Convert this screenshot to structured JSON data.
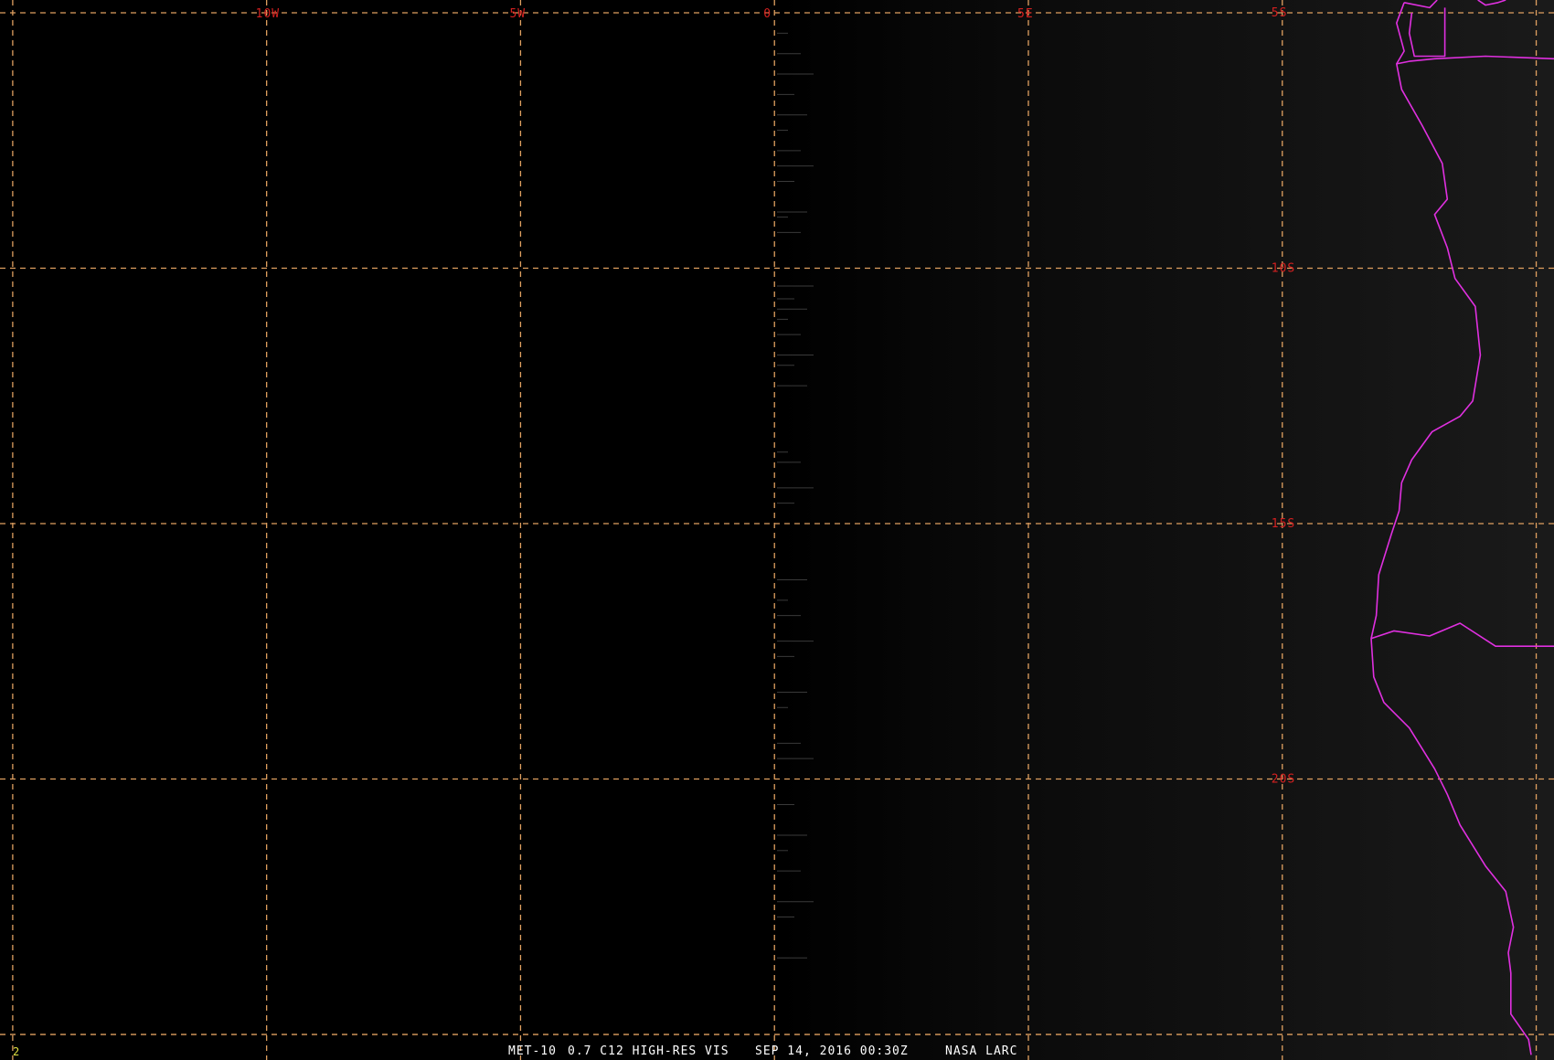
{
  "product": {
    "satellite": "MET-10",
    "channel": "0.7 C12 HIGH-RES VIS",
    "datetime": "SEP 14, 2016 00:30Z",
    "source": "NASA LARC",
    "frame_number": "2"
  },
  "grid": {
    "longitudes": [
      {
        "value": -15,
        "label": ""
      },
      {
        "value": -10,
        "label": "10W"
      },
      {
        "value": -5,
        "label": "5W"
      },
      {
        "value": 0,
        "label": "0"
      },
      {
        "value": 5,
        "label": "5E"
      },
      {
        "value": 10,
        "label": ""
      },
      {
        "value": 15,
        "label": ""
      }
    ],
    "latitudes": [
      {
        "value": -5,
        "label": "5S"
      },
      {
        "value": -10,
        "label": "10S"
      },
      {
        "value": -15,
        "label": "15S"
      },
      {
        "value": -20,
        "label": "20S"
      },
      {
        "value": -25,
        "label": ""
      }
    ],
    "label_longitude": 10
  },
  "extent": {
    "lon_min": -15.25,
    "lon_max": 15.35,
    "lat_max": -4.75,
    "lat_min": -25.5
  },
  "coastline": [
    [
      12.4,
      -4.8
    ],
    [
      12.25,
      -5.2
    ],
    [
      12.4,
      -5.75
    ],
    [
      12.25,
      -6.0
    ],
    [
      12.35,
      -6.5
    ],
    [
      12.75,
      -7.2
    ],
    [
      13.15,
      -7.95
    ],
    [
      13.25,
      -8.65
    ],
    [
      13.0,
      -8.95
    ],
    [
      13.25,
      -9.6
    ],
    [
      13.4,
      -10.2
    ],
    [
      13.8,
      -10.75
    ],
    [
      13.9,
      -11.7
    ],
    [
      13.75,
      -12.6
    ],
    [
      13.5,
      -12.9
    ],
    [
      12.95,
      -13.2
    ],
    [
      12.55,
      -13.75
    ],
    [
      12.35,
      -14.2
    ],
    [
      12.3,
      -14.75
    ],
    [
      12.15,
      -15.2
    ],
    [
      11.9,
      -16.0
    ],
    [
      11.85,
      -16.8
    ],
    [
      11.75,
      -17.25
    ],
    [
      11.8,
      -18.0
    ],
    [
      12.0,
      -18.5
    ],
    [
      12.5,
      -19.0
    ],
    [
      13.0,
      -19.8
    ],
    [
      13.25,
      -20.3
    ],
    [
      13.5,
      -20.9
    ],
    [
      14.0,
      -21.7
    ],
    [
      14.4,
      -22.2
    ],
    [
      14.55,
      -22.9
    ],
    [
      14.45,
      -23.4
    ],
    [
      14.5,
      -23.8
    ],
    [
      14.5,
      -24.6
    ],
    [
      14.85,
      -25.1
    ],
    [
      14.9,
      -25.4
    ]
  ],
  "borders": [
    [
      [
        12.4,
        -4.8
      ],
      [
        12.9,
        -4.9
      ],
      [
        13.05,
        -4.75
      ]
    ],
    [
      [
        13.85,
        -4.75
      ],
      [
        14.0,
        -4.85
      ],
      [
        14.25,
        -4.8
      ],
      [
        14.4,
        -4.75
      ]
    ],
    [
      [
        12.55,
        -5.0
      ],
      [
        12.5,
        -5.4
      ],
      [
        12.6,
        -5.85
      ],
      [
        13.2,
        -5.85
      ],
      [
        13.2,
        -4.9
      ]
    ],
    [
      [
        12.25,
        -6.0
      ],
      [
        12.5,
        -5.95
      ],
      [
        13.0,
        -5.9
      ],
      [
        14.0,
        -5.85
      ],
      [
        15.35,
        -5.9
      ]
    ],
    [
      [
        11.75,
        -17.25
      ],
      [
        12.2,
        -17.1
      ],
      [
        12.9,
        -17.2
      ],
      [
        13.5,
        -16.95
      ],
      [
        14.2,
        -17.4
      ],
      [
        15.35,
        -17.4
      ]
    ]
  ],
  "artifacts": {
    "lon": 0.05,
    "lats": [
      -5.4,
      -5.8,
      -6.2,
      -6.6,
      -7.0,
      -7.3,
      -7.7,
      -8.0,
      -8.3,
      -8.9,
      -9.0,
      -9.3,
      -10.35,
      -10.6,
      -10.8,
      -11.0,
      -11.3,
      -11.7,
      -11.9,
      -12.3,
      -13.6,
      -13.8,
      -14.3,
      -14.6,
      -16.1,
      -16.5,
      -16.8,
      -17.3,
      -17.6,
      -18.3,
      -18.6,
      -19.3,
      -19.6,
      -20.5,
      -21.1,
      -21.4,
      -21.8,
      -22.4,
      -22.7,
      -23.5
    ]
  },
  "colors": {
    "background": "#000000",
    "grid": "#e0a060",
    "grid_label": "#d42020",
    "coastline": "#e030e0",
    "caption": "#ffffff",
    "frame_number": "#e0e040",
    "artifact": "#3a3a3a"
  }
}
